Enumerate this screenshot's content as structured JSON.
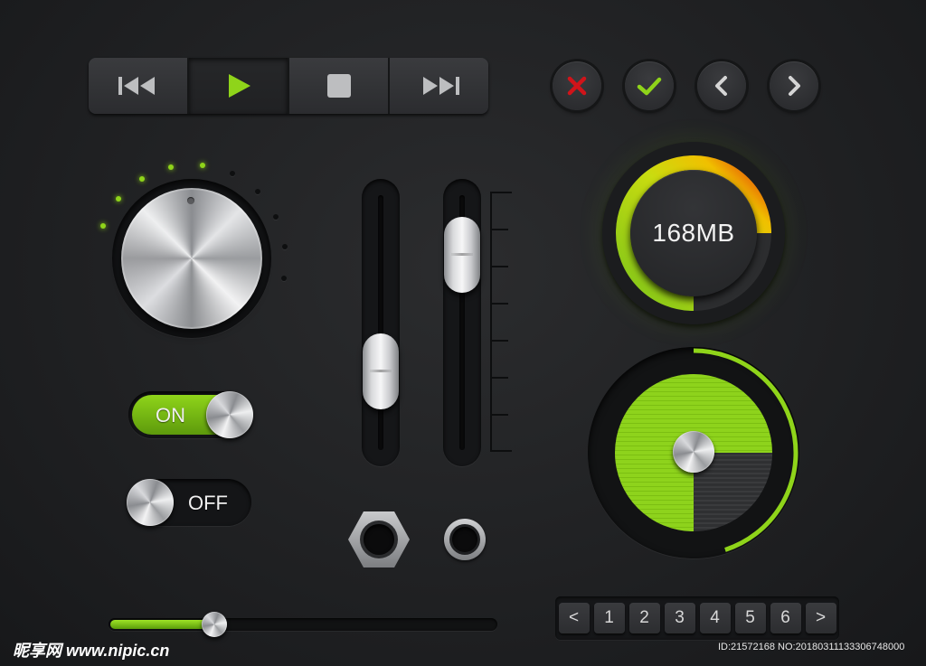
{
  "transport": {
    "buttons": [
      {
        "icon": "skip-back-icon",
        "active": false
      },
      {
        "icon": "play-icon",
        "active": true
      },
      {
        "icon": "stop-icon",
        "active": false
      },
      {
        "icon": "skip-forward-icon",
        "active": false
      }
    ]
  },
  "round_buttons": [
    {
      "icon": "close-icon",
      "color": "#d0141a"
    },
    {
      "icon": "check-icon",
      "color": "#8fd41a"
    },
    {
      "icon": "chevron-left-icon",
      "color": "#d5d5d5"
    },
    {
      "icon": "chevron-right-icon",
      "color": "#d5d5d5"
    }
  ],
  "knob": {
    "level_leds_on": 5,
    "level_leds_total": 10,
    "accent": "#8fd41a"
  },
  "toggles": {
    "on": {
      "label": "ON",
      "state": true
    },
    "off": {
      "label": "OFF",
      "state": false
    }
  },
  "vertical_sliders": [
    {
      "value": 0.25
    },
    {
      "value": 0.85
    }
  ],
  "horizontal_slider": {
    "value": 0.27
  },
  "gauge": {
    "label": "168MB",
    "fraction": 0.75
  },
  "radar": {
    "sweep_fraction": 0.75,
    "ring_fraction": 0.45
  },
  "pagination": {
    "prev_label": "<",
    "next_label": ">",
    "pages": [
      "1",
      "2",
      "3",
      "4",
      "5",
      "6"
    ]
  },
  "watermark": {
    "left": "昵享网 www.nipic.cn",
    "right": "ID:21572168 NO:20180311133306748000"
  },
  "colors": {
    "accent_green": "#8fd41a",
    "danger_red": "#d0141a",
    "background": "#222325"
  }
}
